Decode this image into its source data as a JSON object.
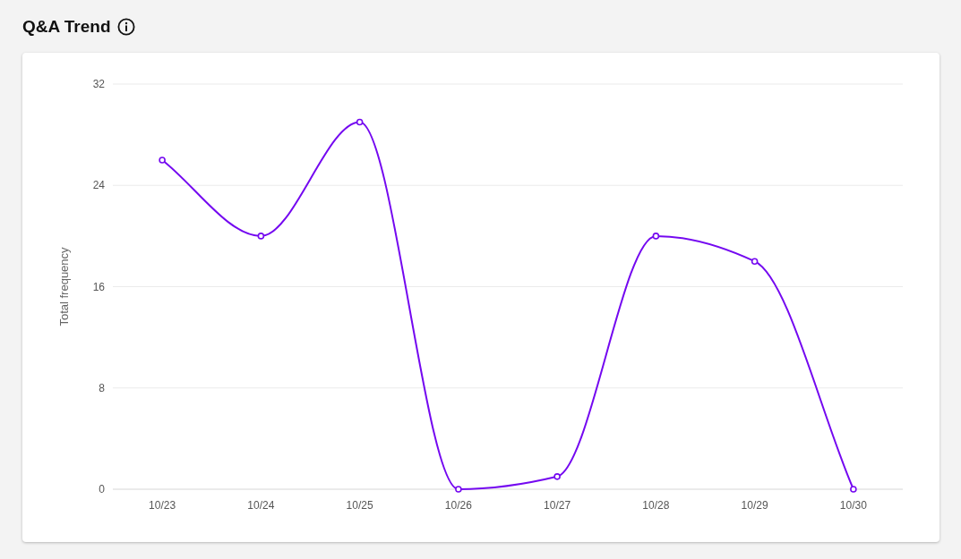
{
  "header": {
    "title": "Q&A Trend"
  },
  "chart_data": {
    "type": "line",
    "ylabel": "Total frequency",
    "categories": [
      "10/23",
      "10/24",
      "10/25",
      "10/26",
      "10/27",
      "10/28",
      "10/29",
      "10/30"
    ],
    "series": [
      {
        "color": "#7408f0",
        "marker": true,
        "values": [
          26,
          20,
          29,
          0,
          1,
          20,
          18,
          0
        ]
      }
    ],
    "grid": true,
    "ylim": [
      0,
      32
    ],
    "yticks": [
      0,
      8,
      16,
      24,
      32
    ]
  }
}
